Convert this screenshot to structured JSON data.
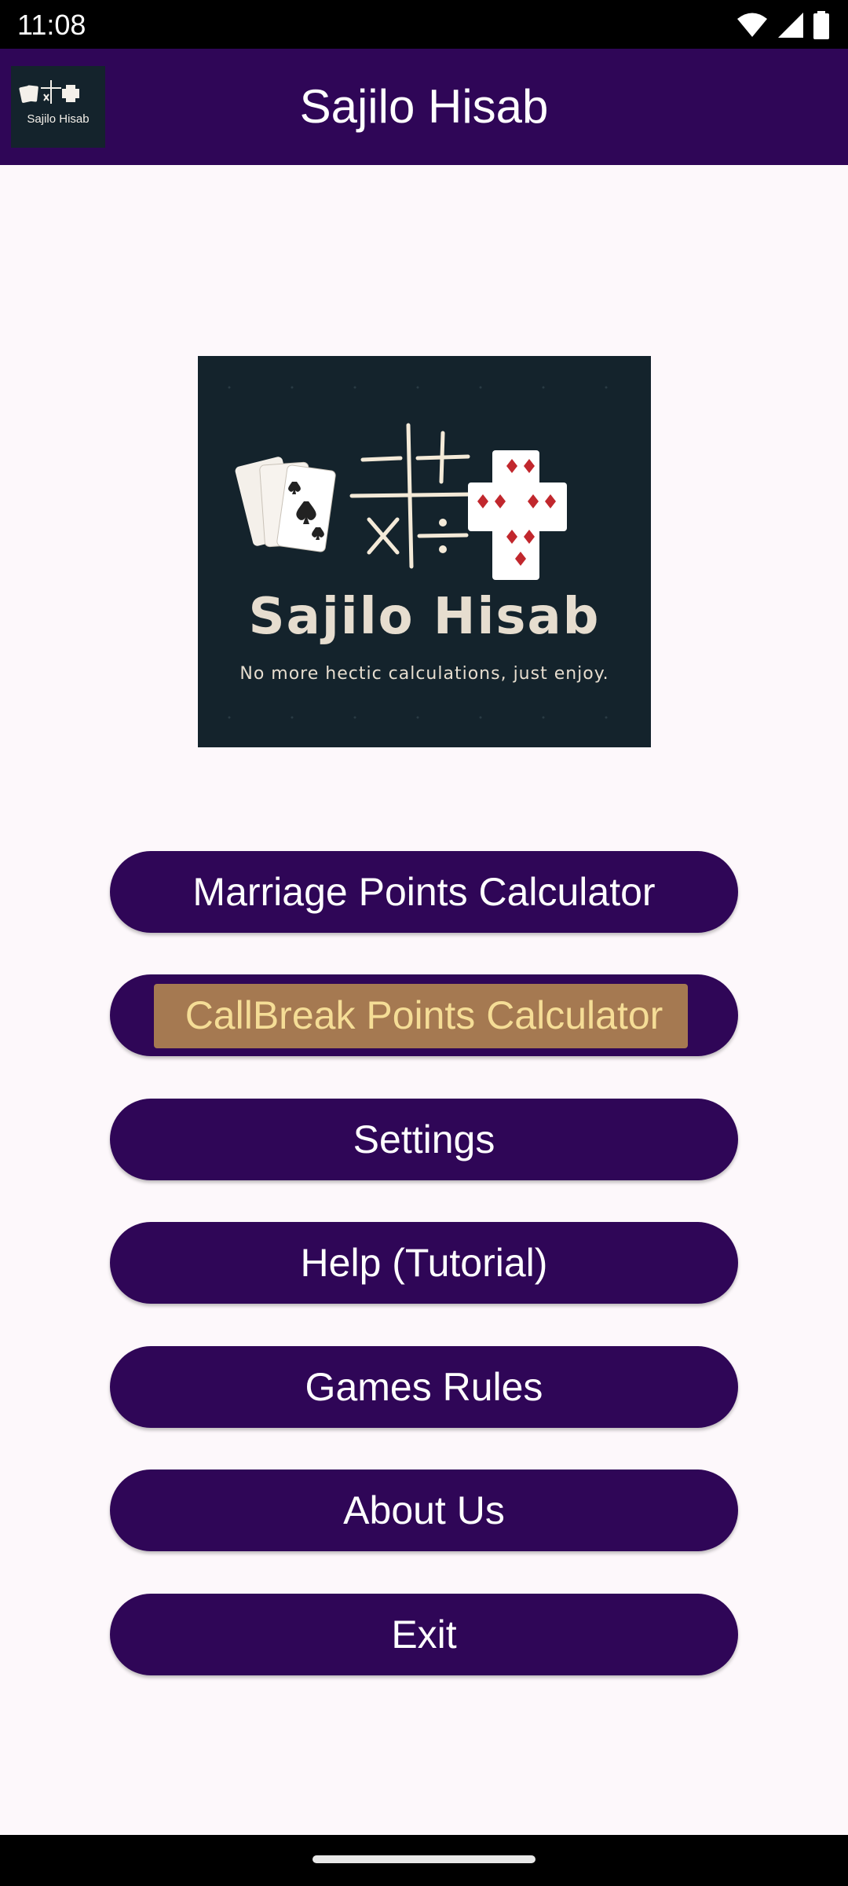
{
  "status_bar": {
    "time": "11:08",
    "icons": [
      "wifi-icon",
      "signal-icon",
      "battery-icon"
    ]
  },
  "app_bar": {
    "title": "Sajilo Hisab",
    "logo_text": "Sajilo Hisab"
  },
  "banner": {
    "title": "Sajilo Hisab",
    "tagline": "No more hectic calculations, just enjoy."
  },
  "menu": {
    "items": [
      {
        "label": "Marriage Points Calculator"
      },
      {
        "label": "CallBreak Points Calculator"
      },
      {
        "label": "Settings"
      },
      {
        "label": "Help (Tutorial)"
      },
      {
        "label": "Games Rules"
      },
      {
        "label": "About Us"
      },
      {
        "label": "Exit"
      }
    ]
  },
  "colors": {
    "primary": "#2f0657",
    "background": "#fdf8fb",
    "banner_bg": "#14232c",
    "highlight": "#a57951",
    "highlight_text": "#f5dd96"
  }
}
